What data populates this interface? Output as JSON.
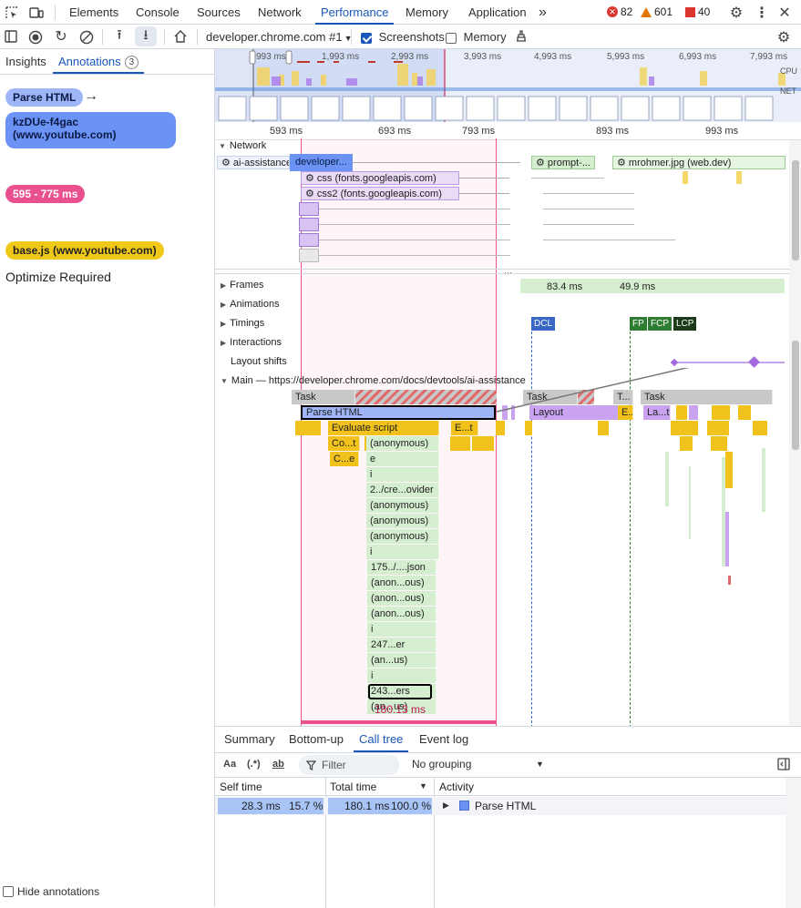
{
  "devtools": {
    "tabs": [
      "Elements",
      "Console",
      "Sources",
      "Network",
      "Performance",
      "Memory",
      "Application"
    ],
    "more_tabs": "»",
    "errors": "82",
    "warnings": "601",
    "issues": "40"
  },
  "toolbar": {
    "recording_select": "developer.chrome.com #1",
    "screenshots_label": "Screenshots",
    "memory_label": "Memory"
  },
  "sidebar": {
    "tabs": {
      "insights": "Insights",
      "annotations": "Annotations",
      "annotations_count": "3"
    },
    "annotations": [
      {
        "label": "Parse HTML",
        "color": "#9eb6f7"
      },
      {
        "label": "kzDUe-f4gac (www.youtube.com)",
        "color": "#6b93f5"
      },
      {
        "label": "595 - 775 ms",
        "color": "#e8508e"
      },
      {
        "label": "base.js (www.youtube.com)",
        "color": "#f0c818"
      }
    ],
    "optimize_text": "Optimize Required",
    "hide_annotations": "Hide annotations"
  },
  "overview": {
    "ticks": [
      "993 ms",
      "1,993 ms",
      "2,993 ms",
      "3,993 ms",
      "4,993 ms",
      "5,993 ms",
      "6,993 ms",
      "7,993 ms"
    ],
    "cpu_label": "CPU",
    "net_label": "NET"
  },
  "ruler": [
    "593 ms",
    "693 ms",
    "793 ms",
    "893 ms",
    "993 ms"
  ],
  "network": {
    "label": "Network",
    "requests": [
      "ai-assistance",
      "developer...",
      "css (fonts.googleapis.com)",
      "css2 (fonts.googleapis.com)",
      "prompt-...",
      "mrohmer.jpg (web.dev)"
    ]
  },
  "tracks": {
    "frames": "Frames",
    "frames_values": [
      "83.4 ms",
      "49.9 ms"
    ],
    "animations": "Animations",
    "timings": "Timings",
    "timing_markers": [
      "DCL",
      "FP",
      "FCP",
      "LCP"
    ],
    "interactions": "Interactions",
    "layout_shifts": "Layout shifts",
    "main": "Main — https://developer.chrome.com/docs/devtools/ai-assistance"
  },
  "flame": {
    "task": "Task",
    "task_short": "T...",
    "parse_html": "Parse HTML",
    "layout": "Layout",
    "evaluate_script": "Evaluate script",
    "e_t": "E...t",
    "e_short": "E...",
    "la_t": "La...t",
    "co_t": "Co...t",
    "c_e": "C...e",
    "stack": [
      "(anonymous)",
      "e",
      "i",
      "2../cre...ovider",
      "(anonymous)",
      "(anonymous)",
      "(anonymous)",
      "i",
      "175../....json",
      "(anon...ous)",
      "(anon...ous)",
      "(anon...ous)",
      "i",
      "247...er",
      "(an...us)",
      "i",
      "243...ers",
      "(an...us)"
    ],
    "duration_label": "180.13 ms"
  },
  "bottom": {
    "tabs": [
      "Summary",
      "Bottom-up",
      "Call tree",
      "Event log"
    ],
    "active_tab": "Call tree",
    "filter_placeholder": "Filter",
    "grouping": "No grouping",
    "headers": {
      "self": "Self time",
      "total": "Total time",
      "activity": "Activity"
    },
    "row": {
      "self_ms": "28.3 ms",
      "self_pct": "15.7 %",
      "total_ms": "180.1 ms",
      "total_pct": "100.0 %",
      "activity": "Parse HTML"
    }
  }
}
